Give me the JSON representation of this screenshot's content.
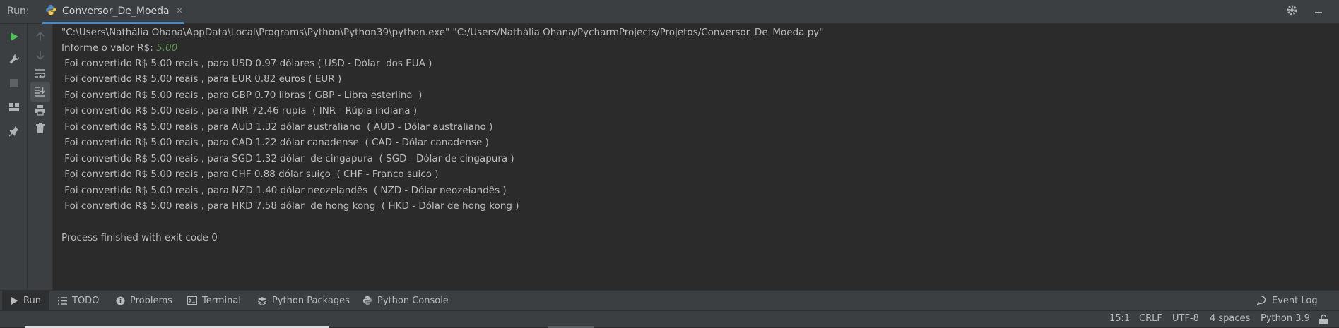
{
  "header": {
    "run_label": "Run:",
    "tab_title": "Conversor_De_Moeda",
    "tab_close": "×"
  },
  "console": {
    "command": "\"C:\\Users\\Nathália Ohana\\AppData\\Local\\Programs\\Python\\Python39\\python.exe\" \"C:/Users/Nathália Ohana/PycharmProjects/Projetos/Conversor_De_Moeda.py\"",
    "prompt": "Informe o valor R$: ",
    "input_value": "5.00",
    "lines": [
      " Foi convertido R$ 5.00 reais , para USD 0.97 dólares ( USD - Dólar  dos EUA )",
      " Foi convertido R$ 5.00 reais , para EUR 0.82 euros ( EUR )",
      " Foi convertido R$ 5.00 reais , para GBP 0.70 libras ( GBP - Libra esterlina  )",
      " Foi convertido R$ 5.00 reais , para INR 72.46 rupia  ( INR - Rúpia indiana )",
      " Foi convertido R$ 5.00 reais , para AUD 1.32 dólar australiano  ( AUD - Dólar australiano )",
      " Foi convertido R$ 5.00 reais , para CAD 1.22 dólar canadense  ( CAD - Dólar canadense )",
      " Foi convertido R$ 5.00 reais , para SGD 1.32 dólar  de cingapura  ( SGD - Dólar de cingapura )",
      " Foi convertido R$ 5.00 reais , para CHF 0.88 dólar suiço  ( CHF - Franco suico )",
      " Foi convertido R$ 5.00 reais , para NZD 1.40 dólar neozelandês  ( NZD - Dólar neozelandês )",
      " Foi convertido R$ 5.00 reais , para HKD 7.58 dólar  de hong kong  ( HKD - Dólar de hong kong )"
    ],
    "exit_message": "Process finished with exit code 0"
  },
  "bottom_tabs": {
    "run": "Run",
    "todo": "TODO",
    "problems": "Problems",
    "terminal": "Terminal",
    "python_packages": "Python Packages",
    "python_console": "Python Console",
    "event_log": "Event Log"
  },
  "status": {
    "position": "15:1",
    "line_separator": "CRLF",
    "encoding": "UTF-8",
    "indent": "4 spaces",
    "interpreter": "Python 3.9"
  },
  "icons": {
    "tab": "python-icon",
    "settings": "gear-icon",
    "minimize": "minimize-icon",
    "rerun": "run-icon",
    "modify": "wrench-icon",
    "stop": "stop-icon",
    "layout": "layout-icon",
    "pin": "pin-icon",
    "up": "arrow-up-icon",
    "down": "arrow-down-icon",
    "wrap": "soft-wrap-icon",
    "scroll": "scroll-to-end-icon",
    "print": "print-icon",
    "trash": "trash-icon",
    "lock": "lock-icon"
  },
  "colors": {
    "background": "#2b2b2b",
    "panel": "#3c3f41",
    "text": "#bbbbbb",
    "input": "#629755",
    "accent": "#4a88c7",
    "run_green": "#4fc258"
  }
}
